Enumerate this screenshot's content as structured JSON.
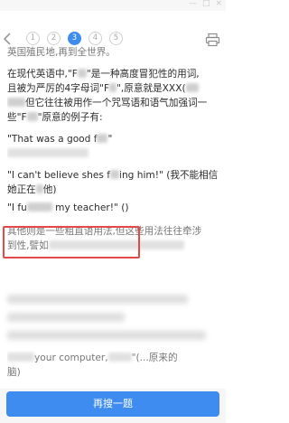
{
  "window": {
    "controls": [
      "—",
      "□",
      "×"
    ]
  },
  "nav": {
    "pages": [
      "1",
      "2",
      "3",
      "4",
      "5"
    ],
    "active_index": 2
  },
  "content": {
    "line0": "英国殖民地,再到全世界。",
    "line1_a": "在现代英语中,\"F",
    "line1_b": "\"是一种高度冒犯性的用词,",
    "line2_a": "且被为严厉的4字母词\"F",
    "line2_b": "\",原意就是XXX(",
    "line3_a": "但它往往被用作一个咒骂语和语气加强词一",
    "line4_a": "些\"F",
    "line4_b": "\"原意的例子有:",
    "ex1_a": "\"That was a good f",
    "ex1_b": "\"",
    "ex2_a": "\"I can't believe shes f",
    "ex2_b": "ing him!\" (我不能相信",
    "ex2_line2": "她正在",
    "ex2_line2_end": "他)",
    "ex3_a": "\"I fu",
    "ex3_b": " my teacher!\" ()",
    "rest1": "其他则是一些粗直语用法,但这些用法往往牵涉",
    "rest2_a": "到性,譬如",
    "rest_tail_a": "your computer,",
    "rest_tail_b": "\"(...原来的",
    "rest_end": "脑)"
  },
  "bottom": {
    "search_button": "再搜一题"
  }
}
